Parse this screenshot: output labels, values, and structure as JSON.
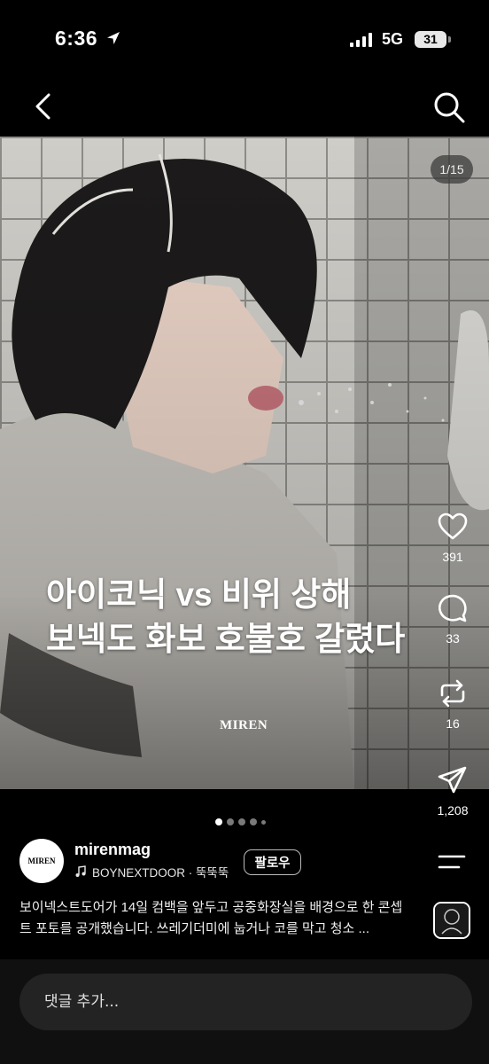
{
  "status_bar": {
    "time": "6:36",
    "network": "5G",
    "battery": "31"
  },
  "nav": {
    "back_icon": "chevron-left-icon",
    "search_icon": "search-icon"
  },
  "post": {
    "counter": "1/15",
    "headline_line1": "아이코닉 vs 비위 상해",
    "headline_line2": "보넥도 화보 호불호 갈렸다",
    "watermark": "MIREN",
    "dots": {
      "total": 5,
      "active_index": 0
    }
  },
  "actions": {
    "like_count": "391",
    "comment_count": "33",
    "repost_count": "16",
    "share_count": "1,208"
  },
  "author": {
    "avatar_text": "MIREN",
    "username": "mirenmag",
    "music": "BOYNEXTDOOR · 뚝뚝뚝",
    "follow_label": "팔로우"
  },
  "caption": "보이넥스트도어가 14일 컴백을 앞두고 공중화장실을 배경으로 한 콘셉트 포토를 공개했습니다. 쓰레기더미에 눕거나 코를 막고 청소 ...",
  "comment": {
    "placeholder": "댓글 추가..."
  }
}
